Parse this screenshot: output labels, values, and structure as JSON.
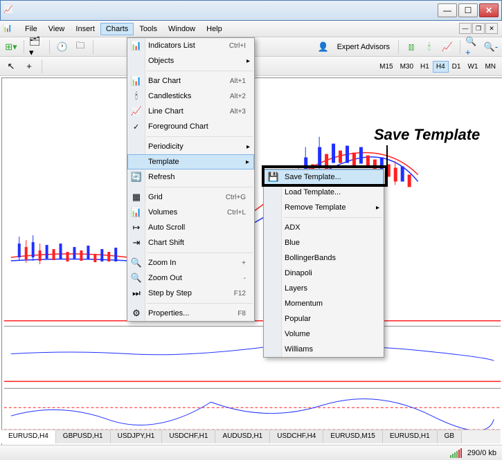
{
  "titlebar": {
    "title": ""
  },
  "menubar": {
    "items": [
      "File",
      "View",
      "Insert",
      "Charts",
      "Tools",
      "Window",
      "Help"
    ],
    "active_index": 3
  },
  "toolbar1": {
    "expert_advisors": "Expert Advisors"
  },
  "toolbar2": {
    "timeframes": [
      "M15",
      "M30",
      "H1",
      "H4",
      "D1",
      "W1",
      "MN"
    ],
    "active_timeframe": "H4"
  },
  "charts_menu": {
    "items": [
      {
        "label": "Indicators List",
        "shortcut": "Ctrl+I",
        "icon": "indicators"
      },
      {
        "label": "Objects",
        "submenu": true,
        "icon": ""
      },
      {
        "sep": true
      },
      {
        "label": "Bar Chart",
        "shortcut": "Alt+1",
        "icon": "bar"
      },
      {
        "label": "Candlesticks",
        "shortcut": "Alt+2",
        "icon": "candle"
      },
      {
        "label": "Line Chart",
        "shortcut": "Alt+3",
        "icon": "line"
      },
      {
        "label": "Foreground Chart",
        "checked": true
      },
      {
        "sep": true
      },
      {
        "label": "Periodicity",
        "submenu": true
      },
      {
        "label": "Template",
        "submenu": true,
        "highlighted": true
      },
      {
        "label": "Refresh",
        "icon": "refresh"
      },
      {
        "sep": true
      },
      {
        "label": "Grid",
        "shortcut": "Ctrl+G",
        "icon": "grid"
      },
      {
        "label": "Volumes",
        "shortcut": "Ctrl+L",
        "icon": "vol"
      },
      {
        "label": "Auto Scroll",
        "icon": "autoscroll"
      },
      {
        "label": "Chart Shift",
        "icon": "shift"
      },
      {
        "sep": true
      },
      {
        "label": "Zoom In",
        "shortcut": "+",
        "icon": "zoomin"
      },
      {
        "label": "Zoom Out",
        "shortcut": "-",
        "icon": "zoomout"
      },
      {
        "label": "Step by Step",
        "shortcut": "F12",
        "icon": "step"
      },
      {
        "sep": true
      },
      {
        "label": "Properties...",
        "shortcut": "F8",
        "icon": "props"
      }
    ]
  },
  "template_submenu": {
    "items": [
      {
        "label": "Save Template...",
        "highlighted": true,
        "icon": "save"
      },
      {
        "label": "Load Template..."
      },
      {
        "label": "Remove Template",
        "submenu": true
      },
      {
        "sep": true
      },
      {
        "label": "ADX"
      },
      {
        "label": "Blue"
      },
      {
        "label": "BollingerBands"
      },
      {
        "label": "Dinapoli"
      },
      {
        "label": "Layers"
      },
      {
        "label": "Momentum"
      },
      {
        "label": "Popular"
      },
      {
        "label": "Volume"
      },
      {
        "label": "Williams"
      }
    ]
  },
  "callout": {
    "label": "Save Template"
  },
  "bottom_tabs": [
    "EURUSD,H4",
    "GBPUSD,H1",
    "USDJPY,H1",
    "USDCHF,H1",
    "AUDUSD,H1",
    "USDCHF,H4",
    "EURUSD,M15",
    "EURUSD,H1",
    "GB"
  ],
  "statusbar": {
    "transfer": "290/0 kb"
  },
  "chart_data": {
    "type": "candlestick",
    "note": "Price chart with red and blue moving-average lines, oscillator subpanels below with dashed and solid lines. Exact numeric axes not visible in screenshot.",
    "series": [
      {
        "name": "price_candles",
        "color_up": "#2030ff",
        "color_down": "#ff2020"
      },
      {
        "name": "ma_fast",
        "color": "#ff2020"
      },
      {
        "name": "ma_slow",
        "color": "#2030ff"
      }
    ],
    "subpanels": 2
  },
  "icons": {
    "indicators": "📊",
    "bar": "📊",
    "candle": "🕯",
    "line": "📈",
    "refresh": "🔄",
    "grid": "▦",
    "vol": "📊",
    "autoscroll": "↦",
    "shift": "⇥",
    "zoomin": "🔍",
    "zoomout": "🔍",
    "step": "⏭",
    "props": "⚙",
    "save": "💾"
  }
}
